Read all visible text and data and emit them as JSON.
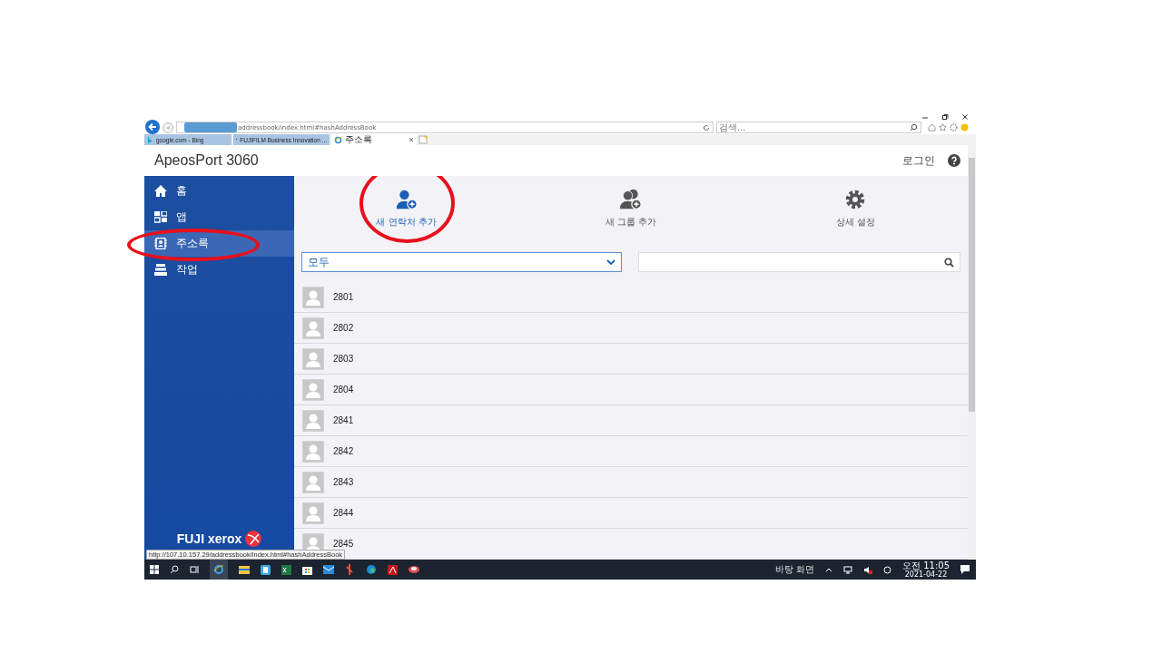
{
  "browser": {
    "address": "addressbook/index.html#hashAddressBook",
    "search_placeholder": "검색...",
    "tabs": [
      {
        "label": "google.com - Bing",
        "kind": "bing",
        "selected": false
      },
      {
        "label": "FUJIFILM Business Innovation ...",
        "kind": "fujifilm",
        "selected": false
      },
      {
        "label": "주소록",
        "kind": "ie",
        "selected": true
      }
    ],
    "status_url": "http://107.10.157.29/addressbook/index.html#hashAddressBook"
  },
  "app": {
    "title": "ApeosPort 3060",
    "login": "로그인"
  },
  "sidebar": {
    "items": [
      {
        "label": "홈",
        "kind": "home",
        "selected": false,
        "circled": false
      },
      {
        "label": "앱",
        "kind": "apps",
        "selected": false,
        "circled": false
      },
      {
        "label": "주소록",
        "kind": "addressbook",
        "selected": true,
        "circled": true
      },
      {
        "label": "작업",
        "kind": "jobs",
        "selected": false,
        "circled": false
      }
    ],
    "brand": "FUJI xerox"
  },
  "actions": [
    {
      "kind": "add-contact",
      "label": "새 연락처 추가",
      "selected": true,
      "circled": true
    },
    {
      "kind": "add-group",
      "label": "새 그룹 추가",
      "selected": false,
      "circled": false
    },
    {
      "kind": "settings",
      "label": "상세 설정",
      "selected": false,
      "circled": false
    }
  ],
  "filter": {
    "value": "모두"
  },
  "contacts": [
    {
      "name": "2801"
    },
    {
      "name": "2802"
    },
    {
      "name": "2803"
    },
    {
      "name": "2804"
    },
    {
      "name": "2841"
    },
    {
      "name": "2842"
    },
    {
      "name": "2843"
    },
    {
      "name": "2844"
    },
    {
      "name": "2845"
    }
  ],
  "taskbar": {
    "tray_label": "바탕 화면",
    "time": "오전 11:05",
    "date": "2021-04-22"
  }
}
